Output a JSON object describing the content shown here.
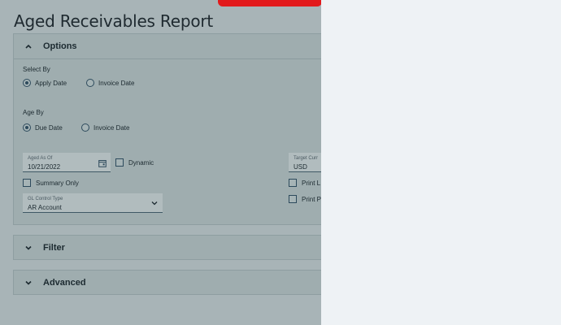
{
  "page": {
    "title": "Aged Receivables Report"
  },
  "options": {
    "header": "Options",
    "select_by": {
      "label": "Select By",
      "apply_date": "Apply Date",
      "invoice_date": "Invoice Date"
    },
    "age_by": {
      "label": "Age By",
      "due_date": "Due Date",
      "invoice_date": "Invoice Date"
    },
    "aged_as_of": {
      "label": "Aged As Of",
      "value": "10/21/2022"
    },
    "dynamic_label": "Dynamic",
    "target_currency": {
      "label": "Target Curr",
      "value": "USD"
    },
    "summary_only_label": "Summary Only",
    "print_1_label": "Print L",
    "print_2_label": "Print P",
    "gl_control_type": {
      "label": "GL Control Type",
      "value": "AR Account"
    }
  },
  "filter": {
    "header": "Filter"
  },
  "advanced": {
    "header": "Advanced"
  },
  "colors": {
    "overlay": "#a8b4b7",
    "accent_red": "#e2191b",
    "panel": "#eef2f5"
  }
}
